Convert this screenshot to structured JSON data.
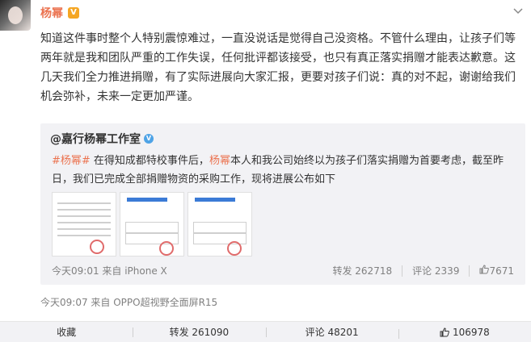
{
  "post": {
    "author": "杨幂",
    "verified_badge": "V",
    "more_icon": "chevron-down-icon",
    "content": "知道这件事时整个人特别震惊难过，一直没说话是觉得自己没资格。不管什么理由，让孩子们等两年就是我和团队严重的工作失误，任何批评都该接受，也只有真正落实捐赠才能表达歉意。这几天我们全力推进捐赠，有了实际进展向大家汇报，更要对孩子们说：真的对不起，谢谢给我们机会弥补，未来一定更加严谨。",
    "meta": "今天09:07 来自 OPPO超视野全面屏R15"
  },
  "repost": {
    "author": "@嘉行杨幂工作室",
    "verified_icon": "blue-v-icon",
    "tag1": "#杨幂#",
    "text_part1": " 在得知成都特校事件后，",
    "tag2": "杨幂",
    "text_part2": "本人和我公司始终以为孩子们落实捐赠为首要考虑，截至昨日，我们已完成全部捐赠物资的采购工作，现将进展公布如下",
    "meta": "今天09:01 来自 iPhone X",
    "repost_count": "转发 262718",
    "comment_count": "评论 2339",
    "like_count": "7671"
  },
  "actions": {
    "favorite": "收藏",
    "repost": "转发 261090",
    "comment": "评论 48201",
    "like": "106978"
  }
}
